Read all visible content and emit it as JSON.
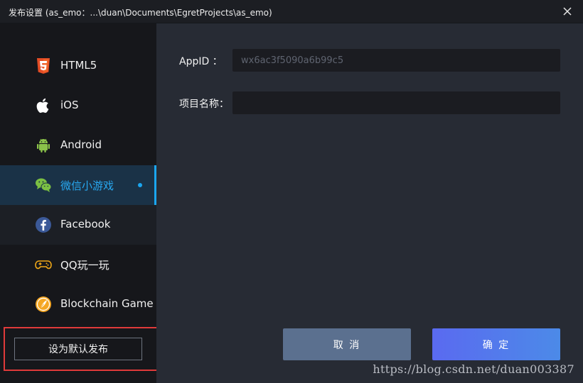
{
  "window": {
    "title": "发布设置 (as_emo：...\\duan\\Documents\\EgretProjects\\as_emo)"
  },
  "sidebar": {
    "items": [
      {
        "label": "HTML5"
      },
      {
        "label": "iOS"
      },
      {
        "label": "Android"
      },
      {
        "label": "微信小游戏"
      },
      {
        "label": "Facebook"
      },
      {
        "label": "QQ玩一玩"
      },
      {
        "label": "Blockchain Game"
      }
    ],
    "default_button_label": "设为默认发布"
  },
  "form": {
    "appid_label": "AppID  ：",
    "appid_placeholder": "wx6ac3f5090a6b99c5",
    "project_name_label": "项目名称：",
    "project_name_value": ""
  },
  "actions": {
    "cancel_label": "取 消",
    "ok_label": "确 定"
  },
  "watermark": "https://blog.csdn.net/duan003387",
  "colors": {
    "accent": "#1ba6f0",
    "html5": "#e44d26",
    "android": "#8bc34a",
    "wechat": "#7bc043",
    "facebook": "#3b5998",
    "qq": "#f0a818",
    "blockchain": "#f5a623",
    "highlight": "#e03a3a"
  },
  "icons": [
    "html5-icon",
    "apple-icon",
    "android-icon",
    "wechat-icon",
    "facebook-icon",
    "qq-game-icon",
    "blockchain-icon",
    "close-icon"
  ]
}
